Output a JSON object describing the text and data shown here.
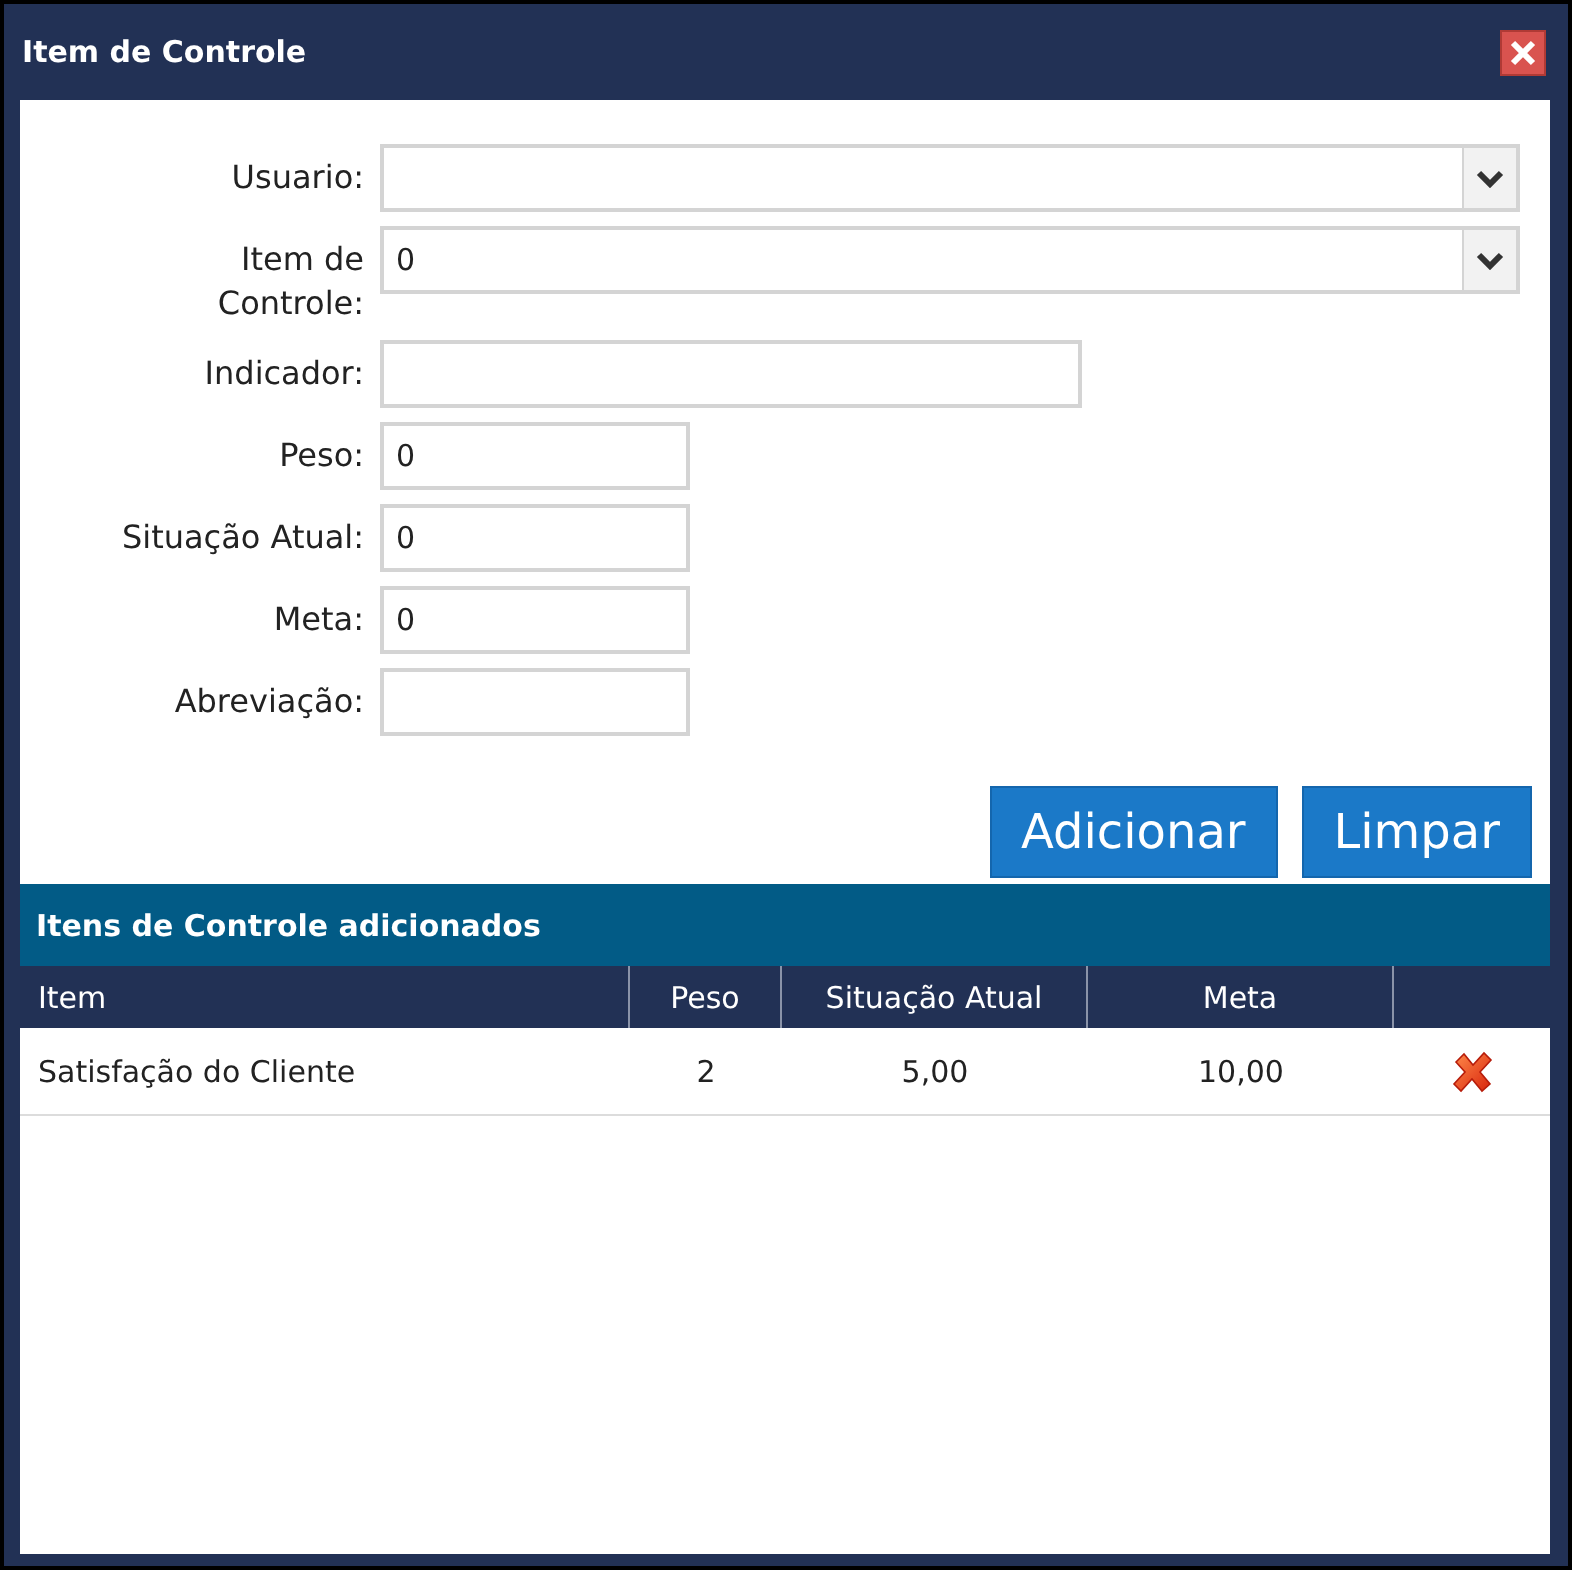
{
  "window": {
    "title": "Item de Controle"
  },
  "form": {
    "fields": [
      {
        "label": "Usuario:",
        "kind": "select"
      },
      {
        "label": "Item de Controle:",
        "kind": "select",
        "value": "0"
      },
      {
        "label": "Indicador:",
        "kind": "text"
      },
      {
        "label": "Peso:",
        "kind": "short",
        "value": "0"
      },
      {
        "label": "Situação Atual:",
        "kind": "short",
        "value": "0"
      },
      {
        "label": "Meta:",
        "kind": "short",
        "value": "0"
      },
      {
        "label": "Abreviação:",
        "kind": "short"
      }
    ],
    "buttons": [
      "Adicionar",
      "Limpar"
    ]
  },
  "added_items": {
    "title": "Itens de Controle adicionados",
    "columns": [
      "Item",
      "Peso",
      "Situação Atual",
      "Meta"
    ],
    "rows": [
      {
        "item": "Satisfação do Cliente",
        "peso": "2",
        "situacao_atual": "5,00",
        "meta": "10,00"
      }
    ]
  }
}
